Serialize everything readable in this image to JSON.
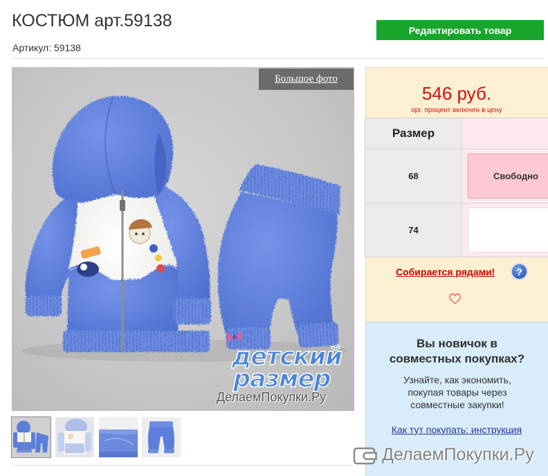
{
  "header": {
    "title": "КОСТЮМ арт.59138",
    "article": "Артикул: 59138",
    "edit_button": "Редактировать товар"
  },
  "gallery": {
    "big_photo": "Большое фото",
    "watermark_logo": [
      "детский",
      "размер"
    ],
    "watermark_site": "ДелаемПокупки.Ру",
    "selected_index": 0,
    "thumbnails": [
      {
        "icon": "suit-full-thumbnail"
      },
      {
        "icon": "jacket-detail-thumbnail"
      },
      {
        "icon": "fabric-closeup-thumbnail"
      },
      {
        "icon": "pants-thumbnail"
      }
    ]
  },
  "price": {
    "value": "546 руб.",
    "note": "орг. процент включен в цену"
  },
  "sizes": {
    "header": "Размер",
    "rows": [
      {
        "size": "68",
        "status": "Свободно"
      },
      {
        "size": "74",
        "status": ""
      }
    ]
  },
  "collection": {
    "label": "Собирается рядами!",
    "help_icon": "question-circle-icon",
    "help_glyph": "?",
    "heart_icon": "heart-outline-icon"
  },
  "newbie": {
    "heading": "Вы новичок в совместных покупках?",
    "text": "Узнайте, как экономить, покупая товары через совместные закупки!",
    "link": "Как тут покупать: инструкция"
  },
  "site_watermark": {
    "icon": "wallet-icon",
    "text": "ДелаемПокупки.Ру"
  },
  "colors": {
    "edit_button": "#17a52b",
    "price": "#cc1111",
    "price_panel": "#fdf0d2",
    "available": "#fcc9d5",
    "newbie_panel": "#d8ecf9",
    "link": "#22339a",
    "garment": "#4d6fcf"
  }
}
